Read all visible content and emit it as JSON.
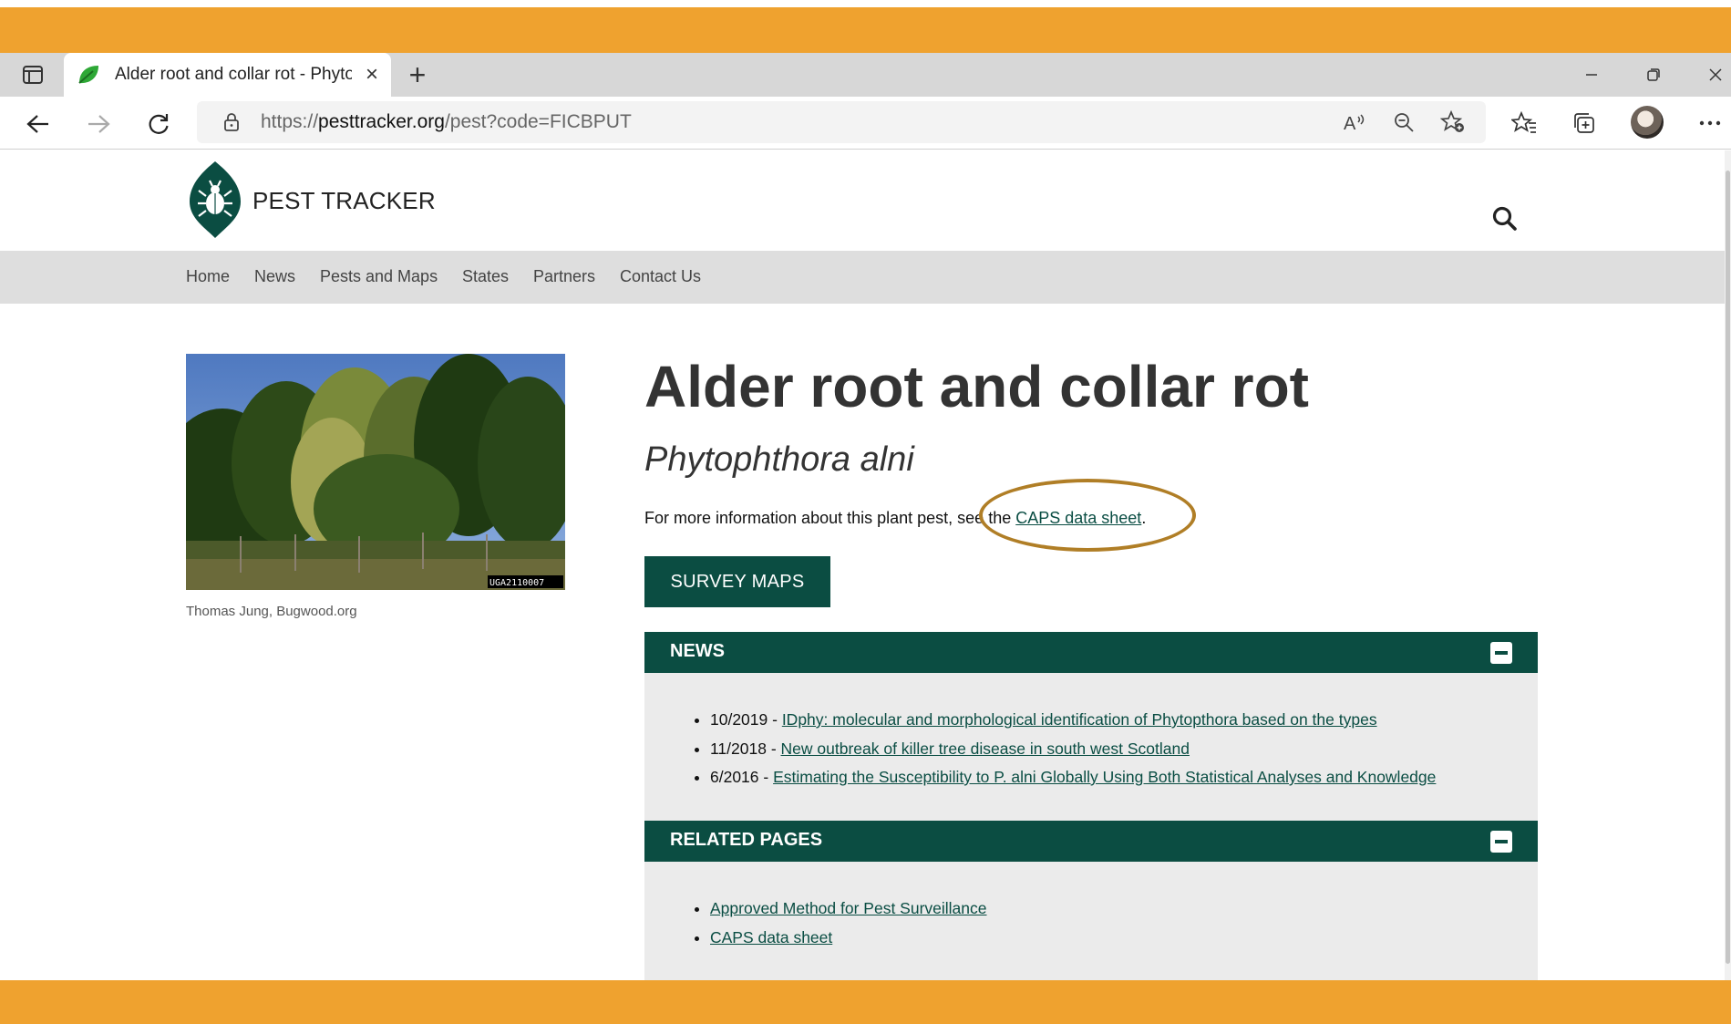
{
  "browser": {
    "tab_title": "Alder root and collar rot - Phytoph",
    "url_prefix": "https://",
    "url_host": "pesttracker.org",
    "url_path": "/pest?code=FICBPUT",
    "new_tab_label": "+",
    "close_tab_label": "×"
  },
  "site": {
    "name": "PEST TRACKER",
    "nav": [
      "Home",
      "News",
      "Pests and Maps",
      "States",
      "Partners",
      "Contact Us"
    ]
  },
  "pest": {
    "title": "Alder root and collar rot",
    "scientific_name": "Phytophthora alni",
    "photo_id": "UGA2110007",
    "photo_credit": "Thomas Jung, Bugwood.org",
    "info_prefix": "For more information about this plant pest, see the ",
    "info_link": "CAPS data sheet",
    "info_suffix": ".",
    "survey_button": "SURVEY MAPS"
  },
  "news": {
    "heading": "NEWS",
    "items": [
      {
        "date": "10/2019 - ",
        "title": "IDphy: molecular and morphological identification of Phytopthora based on the types"
      },
      {
        "date": "11/2018 - ",
        "title": "New outbreak of killer tree disease in south west Scotland"
      },
      {
        "date": "6/2016 - ",
        "title": "Estimating the Susceptibility to P. alni Globally Using Both Statistical Analyses and Knowledge"
      }
    ]
  },
  "related": {
    "heading": "RELATED PAGES",
    "items": [
      "Approved Method for Pest Surveillance",
      "CAPS data sheet"
    ]
  },
  "colors": {
    "frame": "#EFA22F",
    "brand_green": "#0b4d42",
    "callout": "#B07E26"
  }
}
